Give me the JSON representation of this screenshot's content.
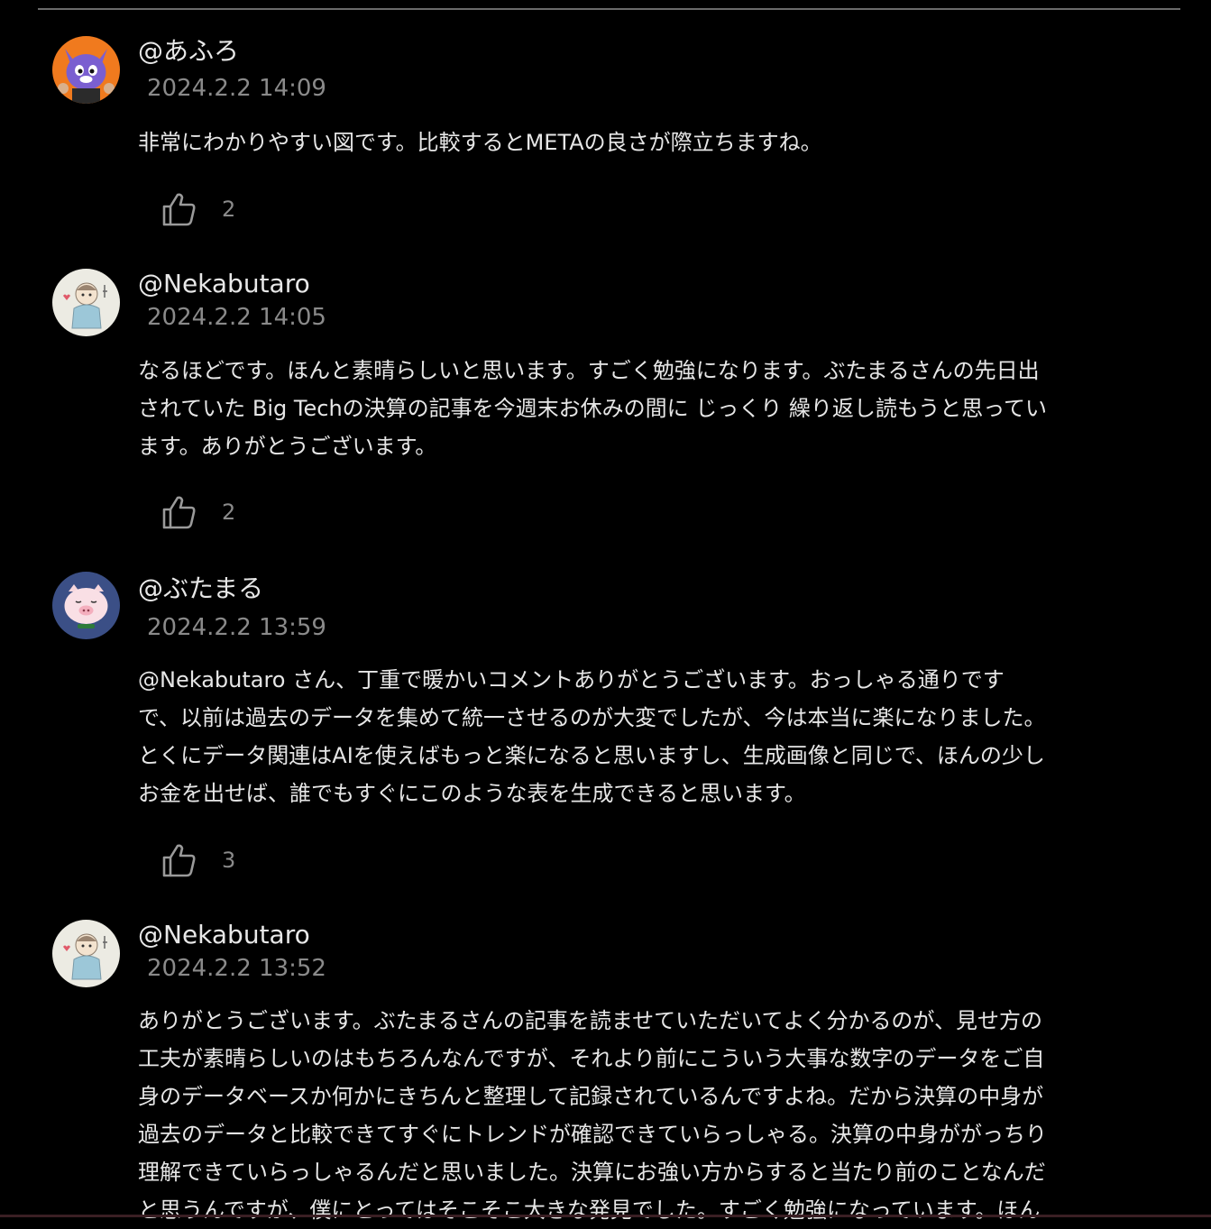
{
  "comments": [
    {
      "username": "@あふろ",
      "timestamp": "2024.2.2 14:09",
      "lines": [
        "非常にわかりやすい図です。比較するとMETAの良さが際立ちますね。"
      ],
      "likes": "2",
      "avatar_icon": "cat-character-avatar"
    },
    {
      "username": "@Nekabutaro",
      "timestamp": "2024.2.2 14:05",
      "lines": [
        "なるほどです。ほんと素晴らしいと思います。すごく勉強になります。ぶたまるさんの先日出",
        "されていた Big Techの決算の記事を今週末お休みの間に じっくり 繰り返し読もうと思ってい",
        "ます。ありがとうございます。"
      ],
      "likes": "2",
      "avatar_icon": "sketch-person-avatar"
    },
    {
      "username": "@ぶたまる",
      "timestamp": "2024.2.2 13:59",
      "lines": [
        "@Nekabutaro さん、丁重で暖かいコメントありがとうございます。おっしゃる通りです",
        "で、以前は過去のデータを集めて統一させるのが大変でしたが、今は本当に楽になりました。",
        "とくにデータ関連はAIを使えばもっと楽になると思いますし、生成画像と同じで、ほんの少し",
        "お金を出せば、誰でもすぐにこのような表を生成できると思います。"
      ],
      "likes": "3",
      "avatar_icon": "pig-avatar"
    },
    {
      "username": "@Nekabutaro",
      "timestamp": "2024.2.2 13:52",
      "lines": [
        "ありがとうございます。ぶたまるさんの記事を読ませていただいてよく分かるのが、見せ方の",
        "工夫が素晴らしいのはもちろんなんですが、それより前にこういう大事な数字のデータをご自",
        "身のデータベースか何かにきちんと整理して記録されているんですよね。だから決算の中身が",
        "過去のデータと比較できてすぐにトレンドが確認できていらっしゃる。決算の中身ががっちり",
        "理解できていらっしゃるんだと思いました。決算にお強い方からすると当たり前のことなんだ",
        "と思うんですが、僕にとってはそこそこ大きな発見でした。すごく勉強になっています。ほん"
      ],
      "likes": "",
      "avatar_icon": "sketch-person-avatar"
    }
  ],
  "colors": {
    "background": "#000000",
    "text": "#e6e6e6",
    "muted": "#8a8a8a",
    "rule": "#6a6a6a"
  },
  "icons": {
    "like": "thumbs-up-icon"
  }
}
